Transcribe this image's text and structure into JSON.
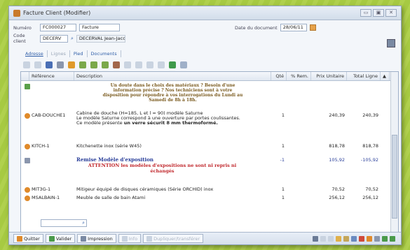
{
  "window": {
    "title": "Facture Client (Modifier)",
    "controls": [
      "▭",
      "▣",
      "✕"
    ]
  },
  "header": {
    "numero_label": "Numéro",
    "numero_value": "FC000027",
    "type_value": "Facture",
    "code_label": "Code client",
    "code_value": "DECERV",
    "client_name": "DECERVAL Jean-Jacques",
    "date_label": "Date du document",
    "date_value": "28/06/11"
  },
  "tabs": [
    {
      "label": "Adresse",
      "state": "active"
    },
    {
      "label": "Lignes",
      "state": "disabled"
    },
    {
      "label": "Pied",
      "state": "normal"
    },
    {
      "label": "Documents",
      "state": "normal"
    }
  ],
  "toolbar": {
    "icons": [
      "select-all-icon",
      "insert-row-icon",
      "delete-row-icon",
      "copy-icon",
      "paste-icon",
      "cut-icon",
      "print-icon",
      "filter-icon",
      "sort-icon",
      "undo-icon",
      "redo-icon",
      "move-up-icon",
      "move-down-icon",
      "go-icon",
      "export-icon"
    ]
  },
  "grid": {
    "columns": [
      "Référence",
      "Description",
      "Qté",
      "% Rem.",
      "Prix Unitaire",
      "Total Ligne"
    ],
    "rows": [
      {
        "icon": "green",
        "ref": "",
        "desc_note": "Un doute dans le choix des matériaux ? Besoin d'une information précise ? Nos techniciens sont à votre disposition pour répondre à vos interrogations du Lundi au Samedi de 8h à 18h.",
        "qty": "",
        "rem": "",
        "price": "",
        "total": ""
      },
      {
        "icon": "orange",
        "ref": "CAB-DOUCHE1",
        "desc_lines": [
          "Cabine de douche (H=185, L et l = 90) modèle Saturne",
          "Le modèle Saturne correspond à une ouverture par portes coulissantes.",
          "Ce modèle présente un verre sécurit 8 mm thermoformé."
        ],
        "desc_bold_part": "un verre sécurit 8 mm thermoformé.",
        "desc_prefix": "Ce modèle présente ",
        "qty": "1",
        "rem": "",
        "price": "240,39",
        "total": "240,39"
      },
      {
        "icon": "orange",
        "ref": "KITCH-1",
        "desc": "Kitchenette inox (série W45)",
        "qty": "1",
        "rem": "",
        "price": "818,78",
        "total": "818,78"
      },
      {
        "icon": "slate",
        "ref": "",
        "desc_title": "Remise Modèle d'exposition",
        "desc_warning": "ATTENTION les modèles d'expositions ne sont ni repris ni échangés",
        "qty": "-1",
        "rem": "",
        "price": "105,92",
        "total": "-105,92"
      },
      {
        "icon": "orange",
        "ref": "MIT3G-1",
        "desc": "Mitigeur équipé de disques céramiques (Série ORCHID) inox",
        "qty": "1",
        "rem": "",
        "price": "70,52",
        "total": "70,52"
      },
      {
        "icon": "orange",
        "ref": "MSALBAIN-1",
        "desc": "Meuble de salle de bain Atami",
        "qty": "1",
        "rem": "",
        "price": "256,12",
        "total": "256,12"
      }
    ]
  },
  "bottom": {
    "quit": "Quitter",
    "validate": "Valider",
    "print": "Impression",
    "info": "Info",
    "transfer": "Dupliquer/transférer"
  },
  "colors": {
    "background": "#a9cc45",
    "accent_blue": "#2a3f9a",
    "warning_red": "#c0262b",
    "note_brown": "#7a5a1e"
  }
}
